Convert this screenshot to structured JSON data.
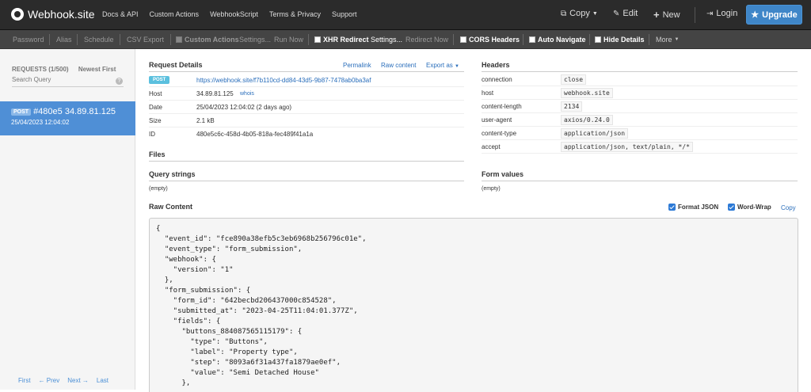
{
  "topbar": {
    "brand": "Webhook.site",
    "nav": [
      "Docs & API",
      "Custom Actions",
      "WebhookScript",
      "Terms & Privacy",
      "Support"
    ],
    "copy": "Copy",
    "edit": "Edit",
    "new": "New",
    "login": "Login",
    "upgrade": "Upgrade"
  },
  "subbar": {
    "password": "Password",
    "alias": "Alias",
    "schedule": "Schedule",
    "csv_export": "CSV Export",
    "custom_actions": "Custom Actions",
    "ca_settings": "Settings...",
    "run_now": "Run Now",
    "xhr_redirect": "XHR Redirect",
    "xhr_settings": "Settings...",
    "redirect_now": "Redirect Now",
    "cors_headers": "CORS Headers",
    "auto_navigate": "Auto Navigate",
    "hide_details": "Hide Details",
    "more": "More"
  },
  "sidebar": {
    "requests_label": "REQUESTS (1/500)",
    "sort": "Newest First",
    "search_placeholder": "Search Query",
    "request": {
      "method": "POST",
      "title": "#480e5 34.89.81.125",
      "date": "25/04/2023 12:04:02"
    },
    "pager": {
      "first": "First",
      "prev": "← Prev",
      "next": "Next →",
      "last": "Last"
    }
  },
  "details": {
    "title": "Request Details",
    "permalink": "Permalink",
    "raw_content": "Raw content",
    "export_as": "Export as",
    "method": "POST",
    "url": "https://webhook.site/f7b110cd-dd84-43d5-9b87-7478ab0ba3af",
    "host_label": "Host",
    "host": "34.89.81.125",
    "whois": "whois",
    "date_label": "Date",
    "date": "25/04/2023 12:04:02 (2 days ago)",
    "size_label": "Size",
    "size": "2.1 kB",
    "id_label": "ID",
    "id": "480e5c6c-458d-4b05-818a-fec489f41a1a",
    "files": "Files",
    "query_strings": "Query strings",
    "query_empty": "(empty)"
  },
  "headers": {
    "title": "Headers",
    "rows": [
      {
        "key": "connection",
        "value": "close"
      },
      {
        "key": "host",
        "value": "webhook.site"
      },
      {
        "key": "content-length",
        "value": "2134"
      },
      {
        "key": "user-agent",
        "value": "axios/0.24.0"
      },
      {
        "key": "content-type",
        "value": "application/json"
      },
      {
        "key": "accept",
        "value": "application/json, text/plain, */*"
      }
    ],
    "form_values": "Form values",
    "form_empty": "(empty)"
  },
  "raw": {
    "title": "Raw Content",
    "format_json": "Format JSON",
    "word_wrap": "Word-Wrap",
    "copy": "Copy",
    "body": "{\n  \"event_id\": \"fce890a38efb5c3eb6968b256796c01e\",\n  \"event_type\": \"form_submission\",\n  \"webhook\": {\n    \"version\": \"1\"\n  },\n  \"form_submission\": {\n    \"form_id\": \"642becbd206437000c854528\",\n    \"submitted_at\": \"2023-04-25T11:04:01.377Z\",\n    \"fields\": {\n      \"buttons_884087565115179\": {\n        \"type\": \"Buttons\",\n        \"label\": \"Property type\",\n        \"step\": \"8093a6f31a437fa1879ae0ef\",\n        \"value\": \"Semi Detached House\"\n      },"
  },
  "colors": {
    "accent": "#4f8fd6",
    "topbar": "#2b2b2b",
    "upgrade": "#3f86c8"
  }
}
